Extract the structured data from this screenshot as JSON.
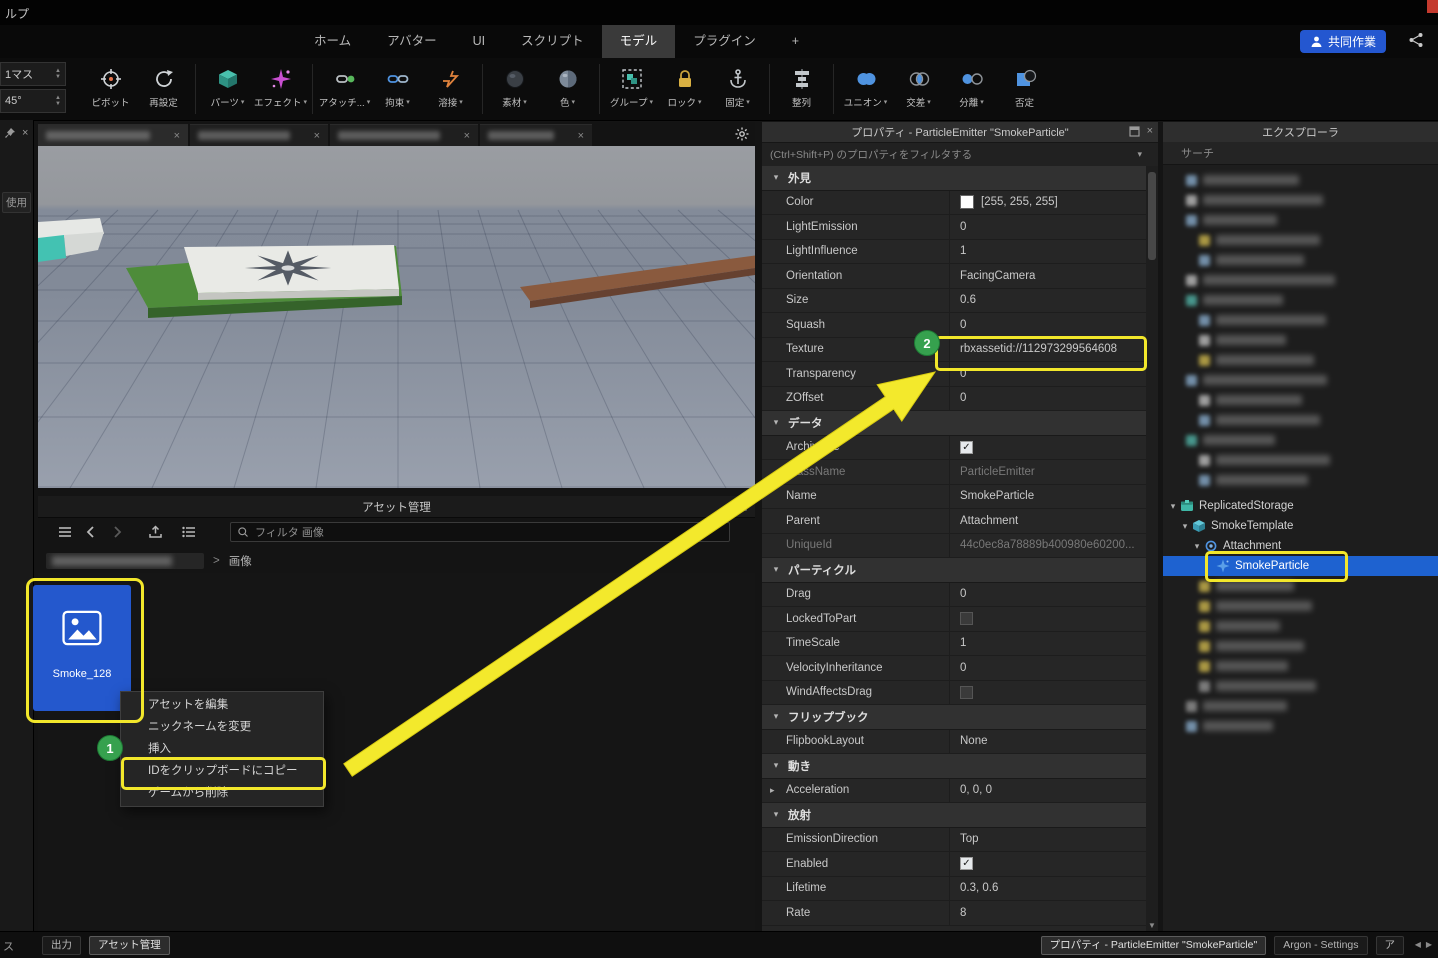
{
  "titlebar": {
    "menu_partial": "ルプ"
  },
  "ribbon": {
    "tabs": [
      {
        "label": "ホーム",
        "active": false
      },
      {
        "label": "アバター",
        "active": false
      },
      {
        "label": "UI",
        "active": false
      },
      {
        "label": "スクリプト",
        "active": false
      },
      {
        "label": "モデル",
        "active": true
      },
      {
        "label": "プラグイン",
        "active": false
      },
      {
        "label": "+",
        "active": false
      }
    ],
    "collab_button": "共同作業"
  },
  "toolbar": {
    "spinners": [
      {
        "value": "1マス"
      },
      {
        "value": "45°"
      }
    ],
    "groups": [
      {
        "items": [
          {
            "label": "ピボット",
            "icon": "pivot",
            "dropdown": false
          },
          {
            "label": "再設定",
            "icon": "reset",
            "dropdown": false
          }
        ]
      },
      {
        "items": [
          {
            "label": "パーツ",
            "icon": "part",
            "dropdown": true
          },
          {
            "label": "エフェクト",
            "icon": "effect",
            "dropdown": true
          }
        ]
      },
      {
        "items": [
          {
            "label": "アタッチ...",
            "icon": "attach",
            "dropdown": true
          },
          {
            "label": "拘束",
            "icon": "constraint",
            "dropdown": true
          },
          {
            "label": "溶接",
            "icon": "weld",
            "dropdown": true
          }
        ]
      },
      {
        "items": [
          {
            "label": "素材",
            "icon": "material",
            "dropdown": true
          },
          {
            "label": "色",
            "icon": "color",
            "dropdown": true
          }
        ]
      },
      {
        "items": [
          {
            "label": "グループ",
            "icon": "group",
            "dropdown": true
          },
          {
            "label": "ロック",
            "icon": "lock",
            "dropdown": true
          },
          {
            "label": "固定",
            "icon": "anchor",
            "dropdown": true
          }
        ]
      },
      {
        "items": [
          {
            "label": "整列",
            "icon": "align",
            "dropdown": false
          }
        ]
      },
      {
        "items": [
          {
            "label": "ユニオン",
            "icon": "union",
            "dropdown": true
          },
          {
            "label": "交差",
            "icon": "intersect",
            "dropdown": true
          },
          {
            "label": "分離",
            "icon": "separate",
            "dropdown": true
          },
          {
            "label": "否定",
            "icon": "negate",
            "dropdown": false
          }
        ]
      }
    ]
  },
  "left_strip": {
    "label": "使用"
  },
  "asset_manager": {
    "title": "アセット管理",
    "filter_placeholder": "フィルタ 画像",
    "breadcrumb_separator": ">",
    "breadcrumb_current": "画像",
    "tile_label": "Smoke_128",
    "context_menu": [
      {
        "label": "アセットを編集"
      },
      {
        "label": "ニックネームを変更"
      },
      {
        "label": "挿入"
      },
      {
        "label": "IDをクリップボードにコピー"
      },
      {
        "label": "ゲームから削除"
      }
    ]
  },
  "annotations": {
    "badge1": "1",
    "badge2": "2"
  },
  "properties": {
    "title": "プロパティ - ParticleEmitter \"SmokeParticle\"",
    "filter_placeholder": "(Ctrl+Shift+P) のプロパティをフィルタする",
    "sections": [
      {
        "name": "外見",
        "rows": [
          {
            "name": "Color",
            "value": "[255, 255, 255]",
            "swatch": "#ffffff"
          },
          {
            "name": "LightEmission",
            "value": "0"
          },
          {
            "name": "LightInfluence",
            "value": "1"
          },
          {
            "name": "Orientation",
            "value": "FacingCamera"
          },
          {
            "name": "Size",
            "value": "0.6"
          },
          {
            "name": "Squash",
            "value": "0"
          },
          {
            "name": "Texture",
            "value": "rbxassetid://112973299564608",
            "highlighted": true
          },
          {
            "name": "Transparency",
            "value": "0"
          },
          {
            "name": "ZOffset",
            "value": "0"
          }
        ]
      },
      {
        "name": "データ",
        "rows": [
          {
            "name": "Archivable",
            "checkbox": true,
            "checked": true
          },
          {
            "name": "ClassName",
            "value": "ParticleEmitter",
            "readonly": true
          },
          {
            "name": "Name",
            "value": "SmokeParticle"
          },
          {
            "name": "Parent",
            "value": "Attachment"
          },
          {
            "name": "UniqueId",
            "value": "44c0ec8a78889b400980e60200...",
            "readonly": true
          }
        ]
      },
      {
        "name": "パーティクル",
        "rows": [
          {
            "name": "Drag",
            "value": "0"
          },
          {
            "name": "LockedToPart",
            "checkbox": true,
            "checked": false
          },
          {
            "name": "TimeScale",
            "value": "1"
          },
          {
            "name": "VelocityInheritance",
            "value": "0"
          },
          {
            "name": "WindAffectsDrag",
            "checkbox": true,
            "checked": false
          }
        ]
      },
      {
        "name": "フリップブック",
        "rows": [
          {
            "name": "FlipbookLayout",
            "value": "None"
          }
        ]
      },
      {
        "name": "動き",
        "rows": [
          {
            "name": "Acceleration",
            "value": "0, 0, 0",
            "expandable": true
          }
        ]
      },
      {
        "name": "放射",
        "rows": [
          {
            "name": "EmissionDirection",
            "value": "Top"
          },
          {
            "name": "Enabled",
            "checkbox": true,
            "checked": true
          },
          {
            "name": "Lifetime",
            "value": "0.3, 0.6"
          },
          {
            "name": "Rate",
            "value": "8"
          }
        ]
      }
    ]
  },
  "explorer": {
    "title": "エクスプローラ",
    "search_placeholder": "サーチ",
    "nodes": [
      {
        "label": "ReplicatedStorage",
        "depth": 0,
        "icon": "storage",
        "expanded": true,
        "selected": false
      },
      {
        "label": "SmokeTemplate",
        "depth": 1,
        "icon": "template",
        "expanded": true,
        "selected": false
      },
      {
        "label": "Attachment",
        "depth": 2,
        "icon": "attachment",
        "expanded": true,
        "selected": false
      },
      {
        "label": "SmokeParticle",
        "depth": 3,
        "icon": "particle",
        "expanded": false,
        "selected": true,
        "highlighted": true
      }
    ]
  },
  "statusbar": {
    "corner_partial": "ス",
    "left_tabs": [
      {
        "label": "出力",
        "active": false
      },
      {
        "label": "アセット管理",
        "active": true
      }
    ],
    "right_tabs": [
      {
        "label": "プロパティ - ParticleEmitter \"SmokeParticle\"",
        "active": true
      },
      {
        "label": "Argon - Settings",
        "active": false
      },
      {
        "label": "ア",
        "active": false
      }
    ]
  }
}
